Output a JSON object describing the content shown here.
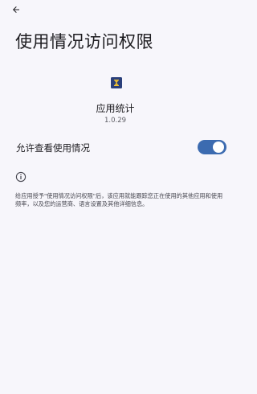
{
  "header": {
    "back_icon": "arrow-left-icon",
    "title": "使用情况访问权限"
  },
  "app": {
    "icon": "hourglass-icon",
    "icon_bg_color": "#2a3f7a",
    "icon_fg_color": "#f2c230",
    "name": "应用统计",
    "version": "1.0.29"
  },
  "permission": {
    "label": "允许查看使用情况",
    "enabled": true,
    "switch_color": "#3c6bb0"
  },
  "info": {
    "icon": "info-icon",
    "description": "给应用授予\"使用情况访问权限\"后，该应用就能跟踪您正在使用的其他应用和使用频率，以及您的运营商、语言设置及其他详细信息。"
  }
}
